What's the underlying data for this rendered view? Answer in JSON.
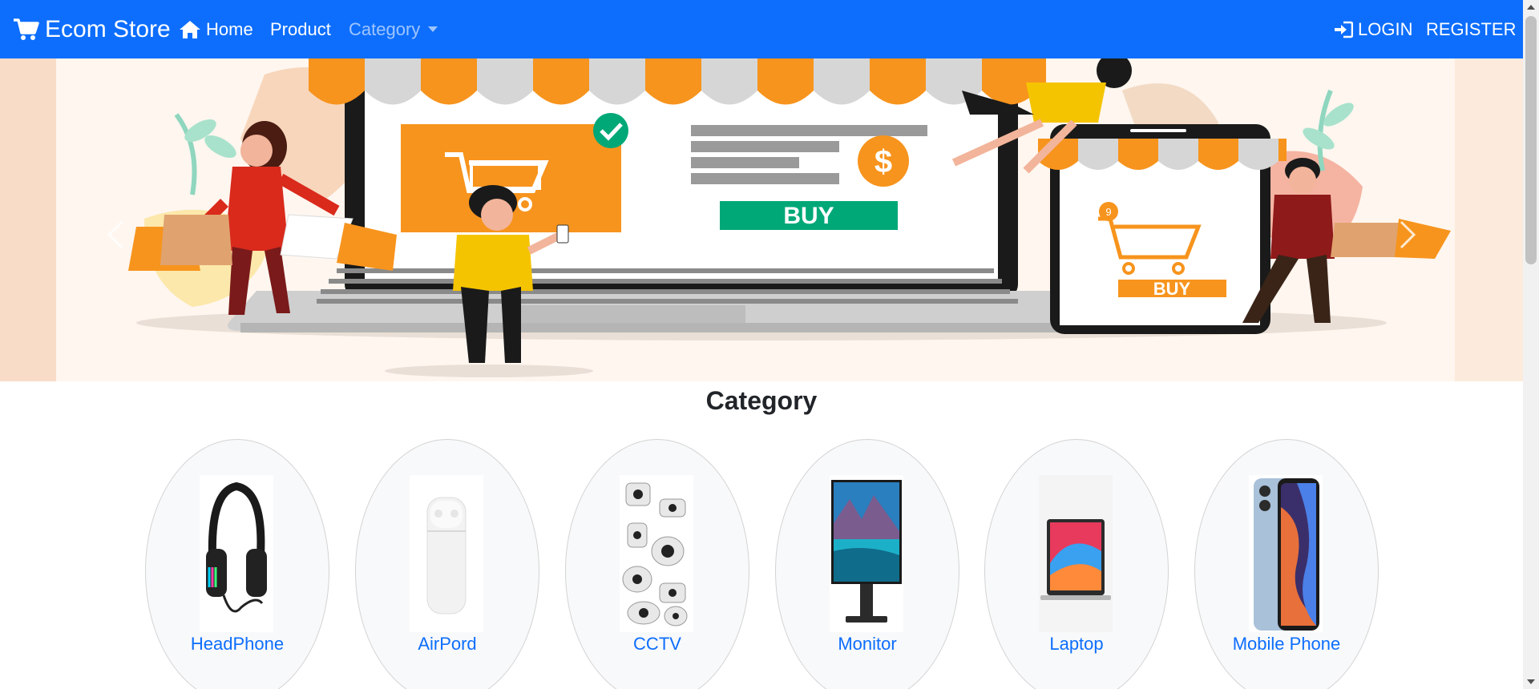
{
  "navbar": {
    "brand": "Ecom Store",
    "home": "Home",
    "product": "Product",
    "category": "Category",
    "login": "LOGIN",
    "register": "REGISTER"
  },
  "banner": {
    "buy_large": "BUY",
    "buy_small": "BUY",
    "dollar": "$",
    "cart_badge": "9"
  },
  "section": {
    "title": "Category"
  },
  "categories": [
    {
      "label": "HeadPhone",
      "icon": "headphone-image"
    },
    {
      "label": "AirPord",
      "icon": "airpods-image"
    },
    {
      "label": "CCTV",
      "icon": "cctv-image"
    },
    {
      "label": "Monitor",
      "icon": "monitor-image"
    },
    {
      "label": "Laptop",
      "icon": "laptop-image"
    },
    {
      "label": "Mobile Phone",
      "icon": "mobile-phone-image"
    }
  ],
  "colors": {
    "primary": "#0d6efd",
    "banner_bg": "#fbe7d8",
    "awning_orange": "#f7941d",
    "buy_green": "#00a878"
  }
}
